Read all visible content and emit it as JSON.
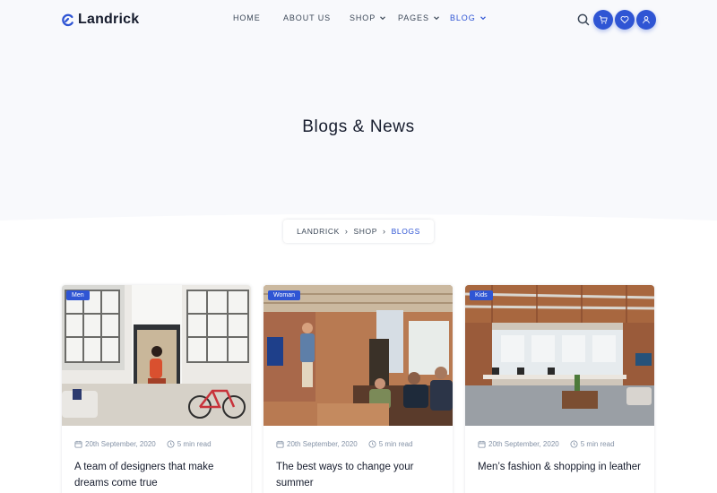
{
  "brand": {
    "name": "Landrick"
  },
  "nav": {
    "items": [
      {
        "label": "HOME"
      },
      {
        "label": "ABOUT US"
      },
      {
        "label": "SHOP"
      },
      {
        "label": "PAGES"
      },
      {
        "label": "BLOG"
      }
    ],
    "active": "BLOG"
  },
  "header_actions": [
    "search-icon",
    "cart-icon",
    "heart-icon",
    "user-icon"
  ],
  "page": {
    "title": "Blogs & News"
  },
  "breadcrumb": [
    {
      "label": "LANDRICK"
    },
    {
      "label": "SHOP"
    },
    {
      "label": "BLOGS"
    }
  ],
  "posts": [
    {
      "category": "Men",
      "date": "20th September, 2020",
      "read_time": "5 min read",
      "title": "A team of designers that make dreams come true"
    },
    {
      "category": "Woman",
      "date": "20th September, 2020",
      "read_time": "5 min read",
      "title": "The best ways to change your summer"
    },
    {
      "category": "Kids",
      "date": "20th September, 2020",
      "read_time": "5 min read",
      "title": "Men’s fashion & shopping in leather"
    }
  ],
  "colors": {
    "primary": "#2f55d4",
    "heading": "#161c2d",
    "text": "#3c4858",
    "muted": "#8492a6",
    "hero_bg": "#f8f9fc"
  }
}
